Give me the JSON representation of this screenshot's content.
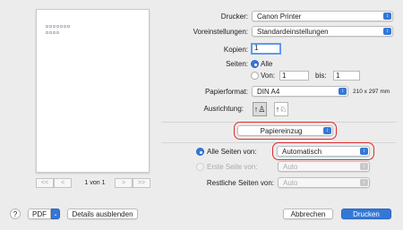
{
  "preview": {
    "prev_first": "<<",
    "prev": "<",
    "next": ">",
    "next_last": ">>",
    "page_count": "1 von 1"
  },
  "settings": {
    "printer_label": "Drucker:",
    "printer_value": "Canon Printer",
    "presets_label": "Voreinstellungen:",
    "presets_value": "Standardeinstellungen",
    "copies_label": "Kopien:",
    "copies_value": "1",
    "pages_label": "Seiten:",
    "pages_all": "Alle",
    "pages_from": "Von:",
    "pages_from_value": "1",
    "pages_to": "bis:",
    "pages_to_value": "1",
    "paper_label": "Papierformat:",
    "paper_value": "DIN A4",
    "paper_dims": "210 x 297 mm",
    "orientation_label": "Ausrichtung:"
  },
  "panel": {
    "selector_value": "Papiereinzug",
    "all_pages_label": "Alle Seiten von:",
    "all_pages_value": "Automatisch",
    "first_page_label": "Erste Seite von:",
    "first_page_value": "Auto",
    "remaining_label": "Restliche Seiten von:",
    "remaining_value": "Auto"
  },
  "footer": {
    "help": "?",
    "pdf": "PDF",
    "details": "Details ausblenden",
    "cancel": "Abbrechen",
    "print": "Drucken"
  },
  "colors": {
    "accent": "#3478d6",
    "highlight": "#e02b2b",
    "background": "#ececec"
  }
}
